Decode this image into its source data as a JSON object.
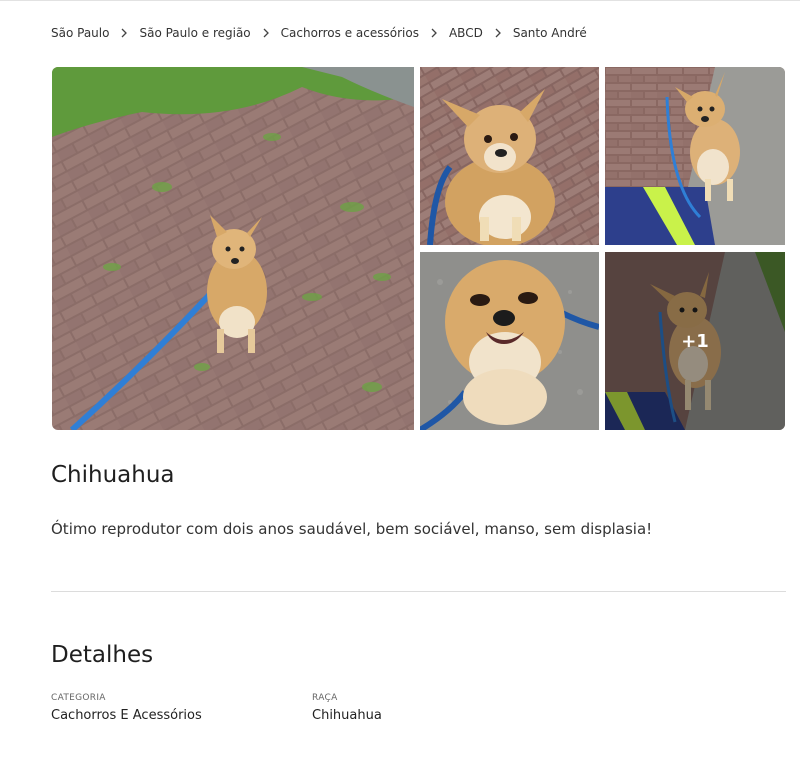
{
  "breadcrumb": {
    "items": [
      "São Paulo",
      "São Paulo e região",
      "Cachorros e acessórios",
      "ABCD",
      "Santo André"
    ]
  },
  "gallery": {
    "more_count": "+1",
    "photos": [
      "chihuahua-on-brick-path",
      "chihuahua-looking-up",
      "chihuahua-on-leash",
      "chihuahua-closeup",
      "chihuahua-more-photos"
    ]
  },
  "listing": {
    "title": "Chihuahua",
    "description": "Ótimo reprodutor com dois anos saudável, bem sociável, manso, sem displasia!"
  },
  "details": {
    "heading": "Detalhes",
    "category_label": "CATEGORIA",
    "category_value": "Cachorros E Acessórios",
    "breed_label": "RAÇA",
    "breed_value": "Chihuahua"
  },
  "colors": {
    "leash_blue": "#2f7fd6",
    "dog_fur": "#d7a868",
    "brick": "#8e6d67",
    "grass": "#6ea246"
  }
}
